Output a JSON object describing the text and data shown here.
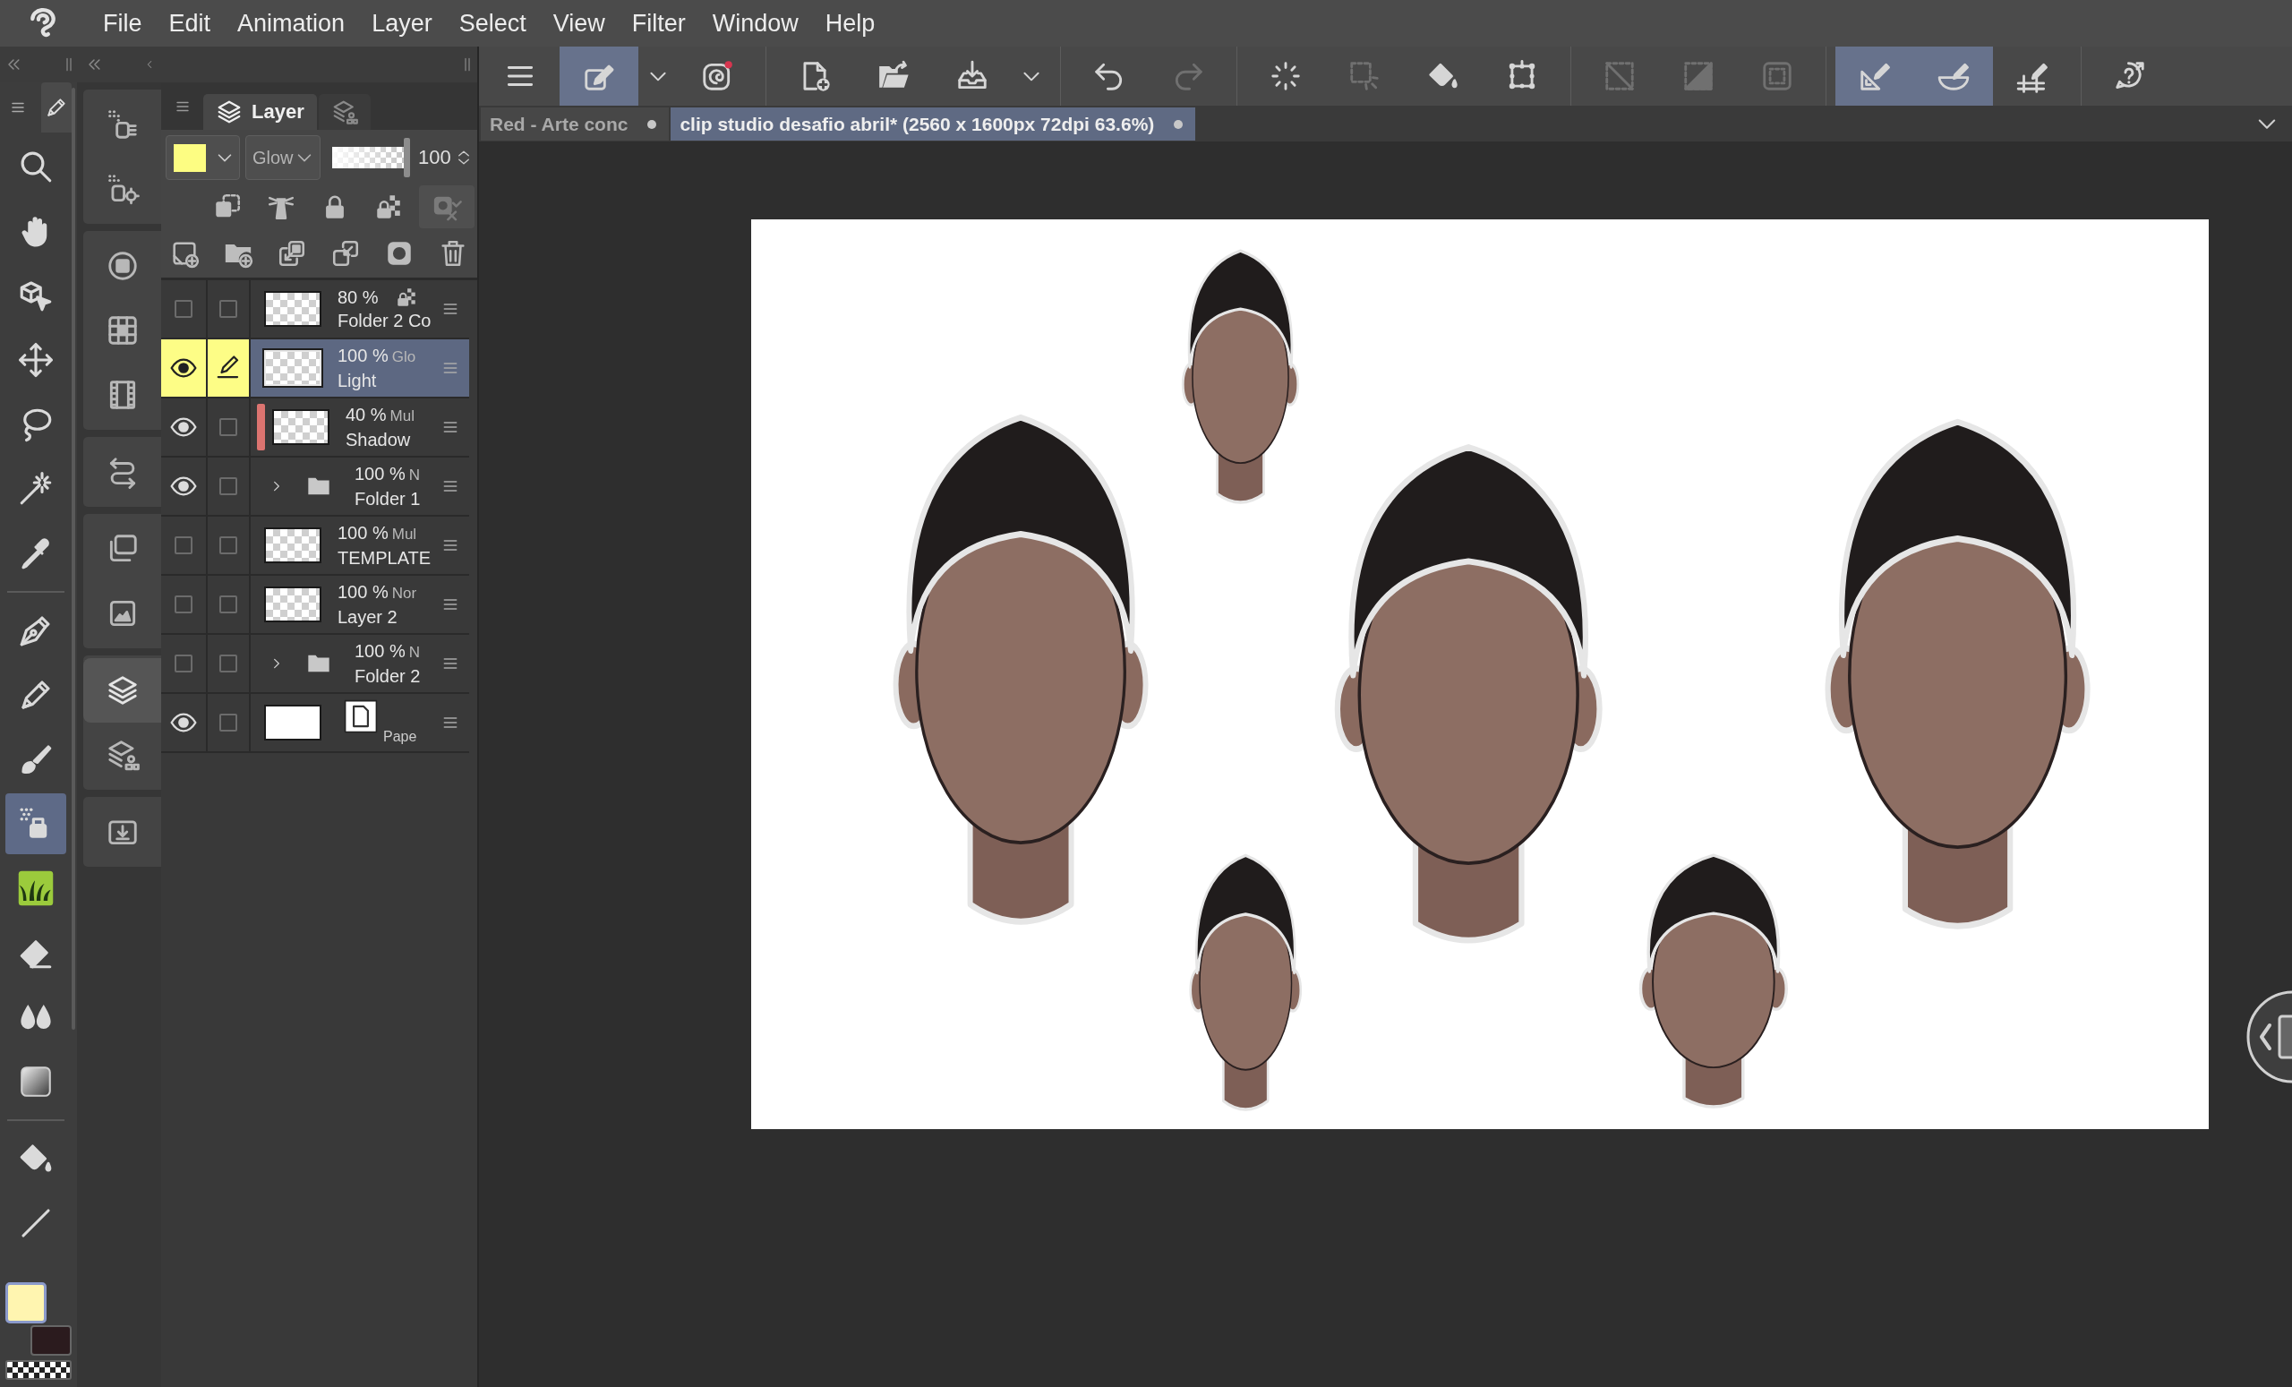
{
  "menu_bar": {
    "items": [
      "File",
      "Edit",
      "Animation",
      "Layer",
      "Select",
      "View",
      "Filter",
      "Window",
      "Help"
    ]
  },
  "command_bar": {
    "groups": [
      {
        "buttons": [
          {
            "selected": false,
            "disabled": false
          },
          {
            "selected": true,
            "disabled": false
          },
          {
            "selected": false,
            "disabled": false
          },
          {
            "selected": false,
            "disabled": false
          }
        ]
      },
      {
        "buttons": [
          {
            "selected": false,
            "disabled": false
          },
          {
            "selected": false,
            "disabled": false
          },
          {
            "selected": false,
            "disabled": false
          },
          {
            "selected": false,
            "disabled": false
          }
        ]
      },
      {
        "buttons": [
          {
            "selected": false,
            "disabled": false
          },
          {
            "selected": false,
            "disabled": true
          }
        ]
      },
      {
        "buttons": [
          {
            "selected": false,
            "disabled": false
          },
          {
            "selected": false,
            "disabled": true
          },
          {
            "selected": false,
            "disabled": false
          },
          {
            "selected": false,
            "disabled": false
          }
        ]
      },
      {
        "buttons": [
          {
            "selected": false,
            "disabled": true
          },
          {
            "selected": false,
            "disabled": true
          },
          {
            "selected": false,
            "disabled": true
          }
        ]
      },
      {
        "buttons": [
          {
            "selected": true,
            "disabled": false
          },
          {
            "selected": true,
            "disabled": false
          },
          {
            "selected": false,
            "disabled": false
          }
        ]
      },
      {
        "buttons": [
          {
            "selected": false,
            "disabled": false
          }
        ]
      }
    ]
  },
  "document_tabs": [
    {
      "label": "Red - Arte conc",
      "selected": false
    },
    {
      "label": "clip studio desafio abril* (2560 x 1600px 72dpi 63.6%)",
      "selected": true
    }
  ],
  "tool_palette": {
    "groups": [
      {
        "tools": [
          {
            "selected": false
          },
          {
            "selected": false
          },
          {
            "selected": false
          },
          {
            "selected": false
          },
          {
            "selected": false
          },
          {
            "selected": false
          },
          {
            "selected": false
          }
        ]
      },
      {
        "tools": [
          {
            "selected": false
          },
          {
            "selected": false
          },
          {
            "selected": false
          },
          {
            "selected": true
          },
          {
            "selected": false
          },
          {
            "selected": false
          },
          {
            "selected": false
          },
          {
            "selected": false
          }
        ]
      },
      {
        "tools": [
          {
            "selected": false
          },
          {
            "selected": false
          }
        ]
      }
    ]
  },
  "color_swatches": [
    {
      "kind": "color",
      "color": "#fff5b0",
      "selected": true
    },
    {
      "kind": "color",
      "color": "#2b1b1e",
      "selected": false
    },
    {
      "kind": "transparent",
      "selected": false
    }
  ],
  "palette_dock": {
    "groups": [
      {
        "items": [
          {
            "selected": false
          },
          {
            "selected": false
          }
        ]
      },
      {
        "items": [
          {
            "selected": false
          },
          {
            "selected": false
          },
          {
            "selected": false
          }
        ]
      },
      {
        "items": [
          {
            "selected": false
          }
        ]
      },
      {
        "items": [
          {
            "selected": false
          },
          {
            "selected": false
          }
        ]
      },
      {
        "items": [
          {
            "selected": true
          },
          {
            "selected": false
          }
        ]
      },
      {
        "items": [
          {
            "selected": false
          }
        ]
      }
    ]
  },
  "layer_panel": {
    "tabs": [
      {
        "label": "Layer",
        "selected": true
      },
      {
        "selected": false
      }
    ],
    "blend_mode": "Glow",
    "opacity": {
      "level": 1,
      "reading": "100"
    },
    "layers": [
      {
        "kind": "raster",
        "opacity": "80 %",
        "name": "Folder 2 Co",
        "visible": false,
        "editing": false,
        "selected": false,
        "transparency_locked": true
      },
      {
        "kind": "raster",
        "opacity": "100 %",
        "blend": "Glo",
        "name": "Light",
        "visible": true,
        "editing": true,
        "selected": true,
        "transparency_locked": false
      },
      {
        "kind": "raster",
        "opacity": "40 %",
        "blend": "Mul",
        "name": "Shadow",
        "color": "#dc7470",
        "visible": true,
        "editing": false,
        "selected": false,
        "transparency_locked": false
      },
      {
        "kind": "folder",
        "expanded": false,
        "opacity": "100 %",
        "blend": "N",
        "name": "Folder 1",
        "visible": true,
        "editing": false,
        "selected": false,
        "transparency_locked": false
      },
      {
        "kind": "raster",
        "opacity": "100 %",
        "blend": "Mul",
        "name": "TEMPLATE",
        "visible": false,
        "editing": false,
        "selected": false,
        "transparency_locked": false
      },
      {
        "kind": "raster",
        "opacity": "100 %",
        "blend": "Nor",
        "name": "Layer 2",
        "visible": false,
        "editing": false,
        "selected": false,
        "transparency_locked": false
      },
      {
        "kind": "folder",
        "expanded": false,
        "opacity": "100 %",
        "blend": "N",
        "name": "Folder 2",
        "visible": false,
        "editing": false,
        "selected": false,
        "transparency_locked": false
      },
      {
        "kind": "paper",
        "name": "Pape",
        "visible": true,
        "editing": false,
        "selected": false,
        "transparency_locked": false
      }
    ]
  }
}
